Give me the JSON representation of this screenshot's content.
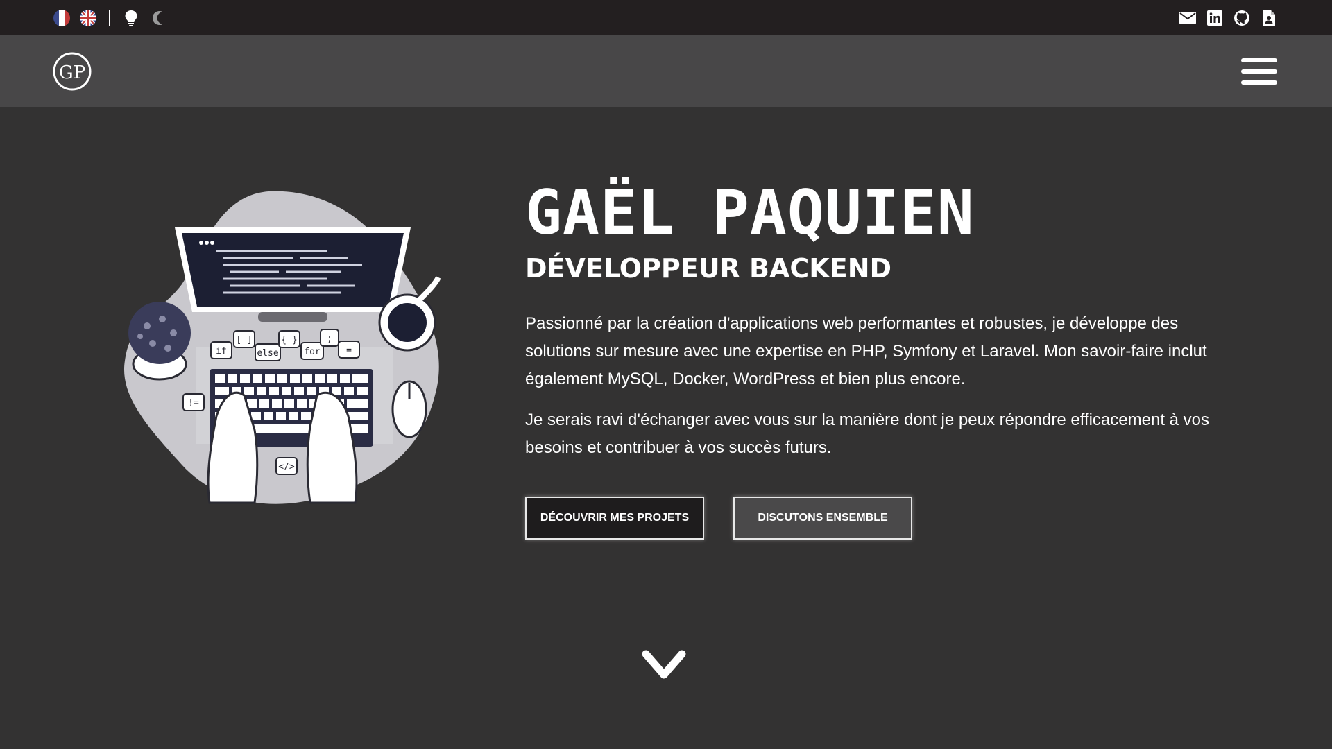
{
  "topbar": {
    "left_icons": [
      "france-flag-icon",
      "uk-flag-icon",
      "lightbulb-icon",
      "moon-icon"
    ],
    "right_icons": [
      "envelope-icon",
      "linkedin-icon",
      "github-icon",
      "resume-file-icon"
    ]
  },
  "navbar": {
    "logo_text": "GP",
    "menu_icon": "hamburger-menu-icon"
  },
  "hero": {
    "name": "GAËL PAQUIEN",
    "role": "DÉVELOPPEUR BACKEND",
    "paragraph1": "Passionné par la création d'applications web performantes et robustes, je développe des solutions sur mesure avec une expertise en PHP, Symfony et Laravel. Mon savoir-faire inclut également MySQL, Docker, WordPress et bien plus encore.",
    "paragraph2": "Je serais ravi d'échanger avec vous sur la manière dont je peux répondre efficacement à vos besoins et contribuer à vos succès futurs.",
    "primary_button": "DÉCOUVRIR MES PROJETS",
    "secondary_button": "DISCUTONS ENSEMBLE",
    "illustration_labels": {
      "if": "if",
      "brackets": "[ ]",
      "else": "else",
      "braces": "{ }",
      "for": "for",
      "semicolon": ";",
      "equals": "=",
      "not_equal": "!=",
      "tag": "</>"
    }
  },
  "scroll_icon": "chevron-down-icon",
  "colors": {
    "topbar_bg": "#231f20",
    "navbar_bg": "#484748",
    "page_bg": "#333232",
    "primary_button_bg": "#1e1c1d",
    "secondary_button_bg": "#4a494a",
    "text": "#ffffff"
  }
}
